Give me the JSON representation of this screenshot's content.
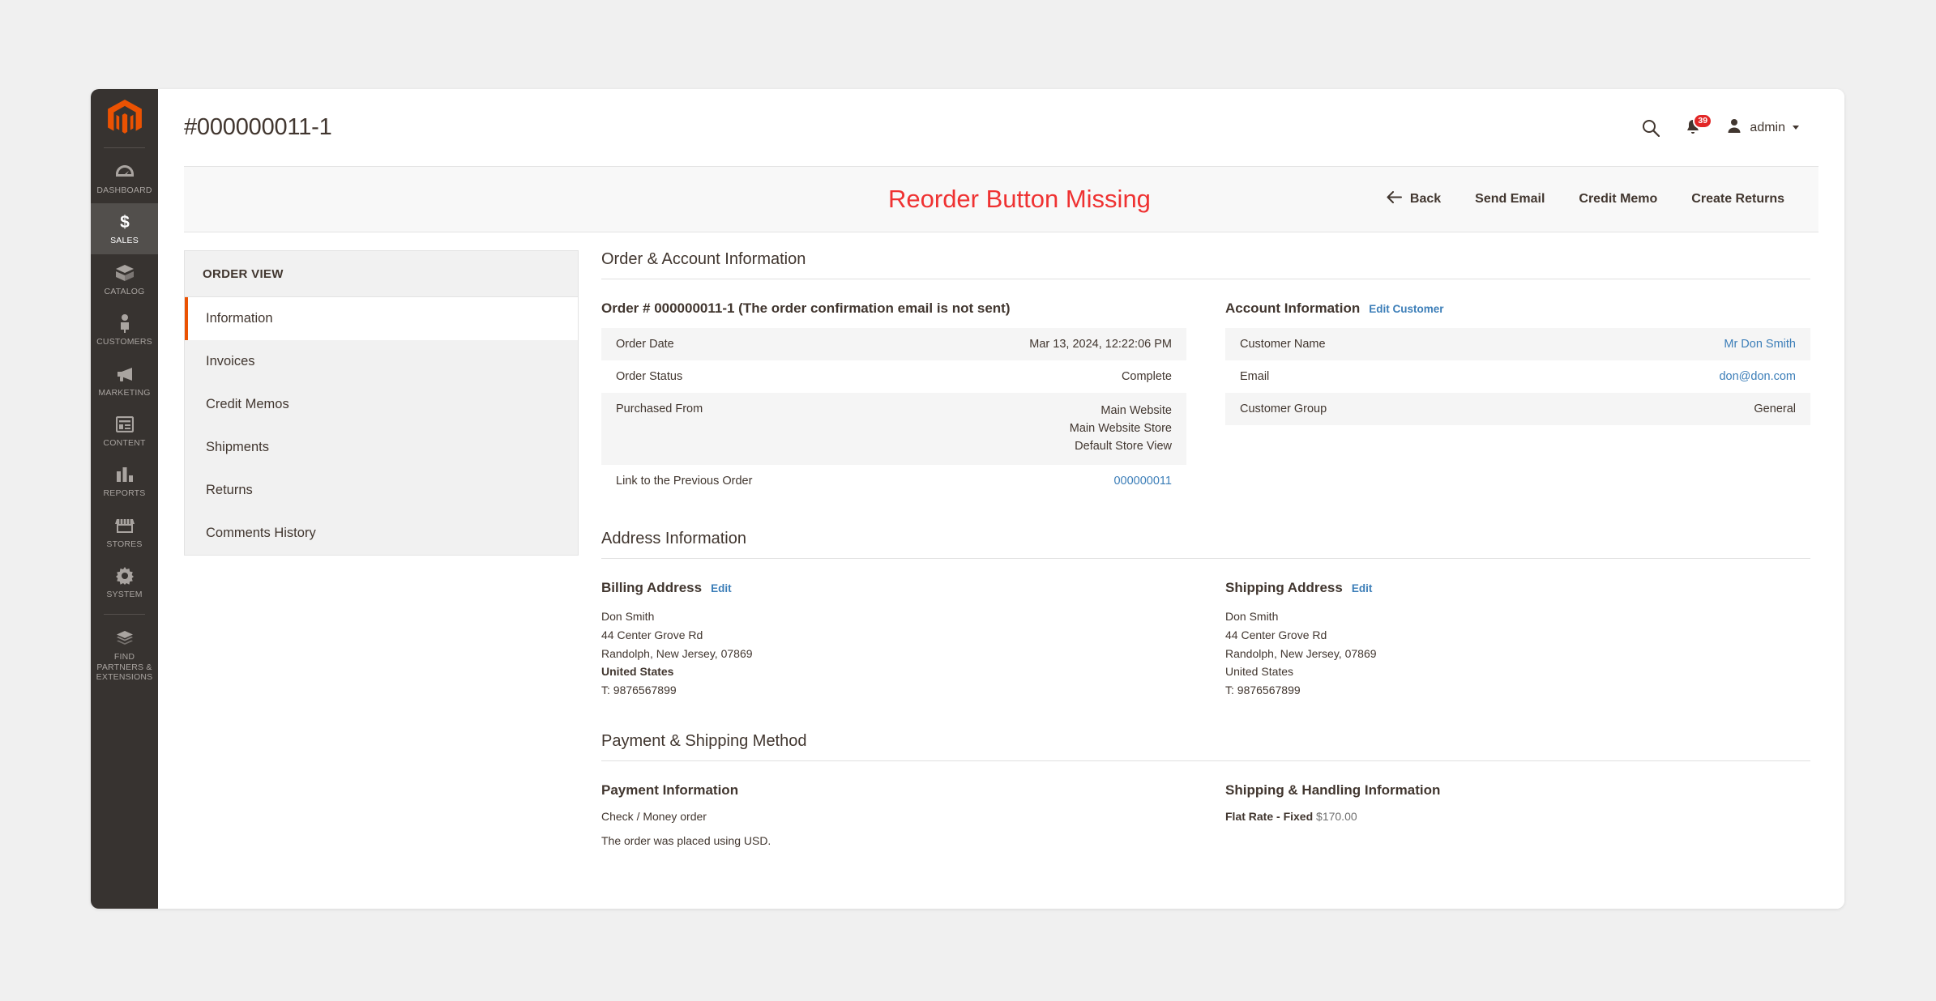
{
  "sidebar": {
    "logo_name": "magento-logo",
    "items": [
      {
        "label": "DASHBOARD",
        "icon": "dashboard-icon",
        "active": false
      },
      {
        "label": "SALES",
        "icon": "sales-icon",
        "active": true
      },
      {
        "label": "CATALOG",
        "icon": "catalog-icon",
        "active": false
      },
      {
        "label": "CUSTOMERS",
        "icon": "customers-icon",
        "active": false
      },
      {
        "label": "MARKETING",
        "icon": "marketing-icon",
        "active": false
      },
      {
        "label": "CONTENT",
        "icon": "content-icon",
        "active": false
      },
      {
        "label": "REPORTS",
        "icon": "reports-icon",
        "active": false
      },
      {
        "label": "STORES",
        "icon": "stores-icon",
        "active": false
      },
      {
        "label": "SYSTEM",
        "icon": "system-icon",
        "active": false
      },
      {
        "label": "FIND PARTNERS & EXTENSIONS",
        "icon": "partners-icon",
        "active": false
      }
    ]
  },
  "header": {
    "title": "#000000011-1",
    "search_icon": "search-icon",
    "notifications_icon": "bell-icon",
    "notifications_count": "39",
    "avatar_icon": "user-avatar-icon",
    "admin_label": "admin"
  },
  "actionbar": {
    "annotation": "Reorder Button Missing",
    "back_label": "Back",
    "back_icon": "arrow-left-icon",
    "buttons": [
      "Send Email",
      "Credit Memo",
      "Create Returns"
    ]
  },
  "orderview": {
    "heading": "ORDER VIEW",
    "items": [
      {
        "label": "Information",
        "active": true
      },
      {
        "label": "Invoices",
        "active": false
      },
      {
        "label": "Credit Memos",
        "active": false
      },
      {
        "label": "Shipments",
        "active": false
      },
      {
        "label": "Returns",
        "active": false
      },
      {
        "label": "Comments History",
        "active": false
      }
    ]
  },
  "order_account": {
    "section_title": "Order & Account Information",
    "order_heading": "Order # 000000011-1 (The order confirmation email is not sent)",
    "rows": [
      {
        "label": "Order Date",
        "value": "Mar 13, 2024, 12:22:06 PM"
      },
      {
        "label": "Order Status",
        "value": "Complete"
      },
      {
        "label": "Purchased From",
        "value": "Main Website\nMain Website Store\nDefault Store View"
      }
    ],
    "previous_order_label": "Link to the Previous Order",
    "previous_order_value": "000000011",
    "account_heading": "Account Information",
    "edit_customer_label": "Edit Customer",
    "account_rows": [
      {
        "label": "Customer Name",
        "value": "Mr Don Smith",
        "link": true
      },
      {
        "label": "Email",
        "value": "don@don.com",
        "link": true
      },
      {
        "label": "Customer Group",
        "value": "General",
        "link": false
      }
    ]
  },
  "address": {
    "section_title": "Address Information",
    "billing_title": "Billing Address",
    "billing_edit": "Edit",
    "billing_lines": [
      "Don Smith",
      "44 Center Grove Rd",
      "Randolph, New Jersey, 07869",
      "United States",
      "T: 9876567899"
    ],
    "shipping_title": "Shipping Address",
    "shipping_edit": "Edit",
    "shipping_lines": [
      "Don Smith",
      "44 Center Grove Rd",
      "Randolph, New Jersey, 07869",
      "United States",
      "T: 9876567899"
    ]
  },
  "payment_shipping": {
    "section_title": "Payment & Shipping Method",
    "payment_title": "Payment Information",
    "payment_method": "Check / Money order",
    "payment_currency_note": "The order was placed using USD.",
    "shipping_title": "Shipping & Handling Information",
    "shipping_method": "Flat Rate - Fixed",
    "shipping_amount": "$170.00"
  },
  "colors": {
    "accent": "#eb5202",
    "sidebar": "#373330",
    "sidebar_active": "#524f4c",
    "link": "#3c7eb8",
    "annotation": "#ef3232",
    "badge": "#e22626"
  }
}
